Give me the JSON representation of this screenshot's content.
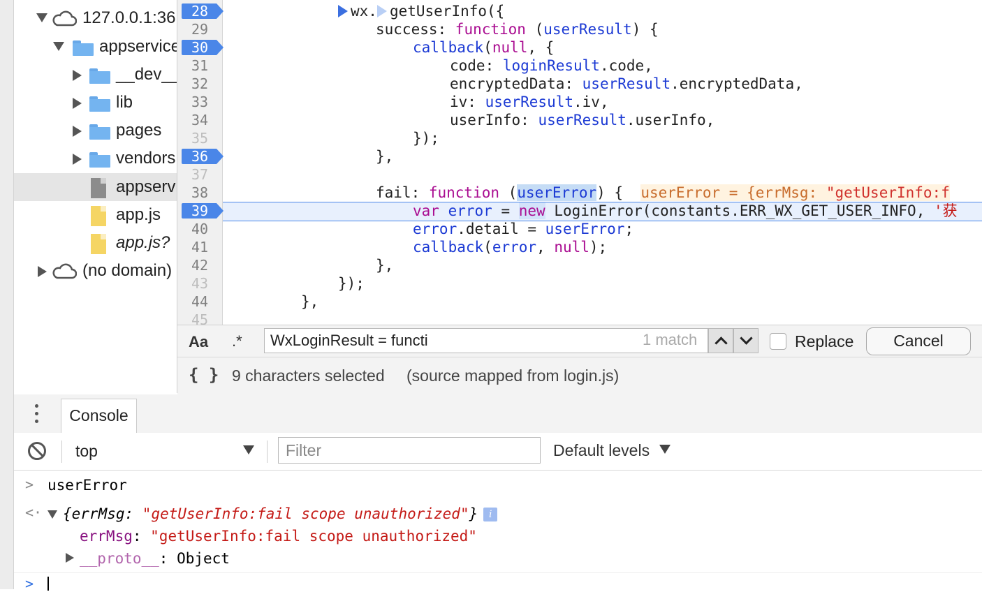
{
  "file_tree": {
    "items": [
      {
        "label": "127.0.0.1:36",
        "type": "domain",
        "expanded": true
      },
      {
        "label": "appservice",
        "type": "folder",
        "expanded": true
      },
      {
        "label": "__dev__",
        "type": "folder",
        "expanded": false
      },
      {
        "label": "lib",
        "type": "folder",
        "expanded": false
      },
      {
        "label": "pages",
        "type": "folder",
        "expanded": false
      },
      {
        "label": "vendors",
        "type": "folder",
        "expanded": false
      },
      {
        "label": "appservice",
        "type": "file",
        "selected": true
      },
      {
        "label": "app.js",
        "type": "file"
      },
      {
        "label": "app.js? ",
        "type": "file"
      },
      {
        "label": "(no domain)",
        "type": "domain",
        "expanded": false
      }
    ]
  },
  "editor": {
    "line_numbers": [
      "28",
      "29",
      "30",
      "31",
      "32",
      "33",
      "34",
      "35",
      "36",
      "37",
      "38",
      "39",
      "40",
      "41",
      "42",
      "43",
      "44",
      "45"
    ],
    "breakpoints": [
      "28",
      "30",
      "36",
      "39"
    ],
    "paused_line": "39",
    "code": {
      "l28_wx": "wx.",
      "l28_rest": "getUserInfo({",
      "l29_a": "success: ",
      "l29_kw": "function",
      "l29_b": " (",
      "l29_v": "userResult",
      "l29_c": ") {",
      "l30_a": "callback",
      "l30_b": "(",
      "l30_kw": "null",
      "l30_c": ", {",
      "l31_a": "code: ",
      "l31_v": "loginResult",
      "l31_b": ".code,",
      "l32_a": "encryptedData: ",
      "l32_v": "userResult",
      "l32_b": ".encryptedData,",
      "l33_a": "iv: ",
      "l33_v": "userResult",
      "l33_b": ".iv,",
      "l34_a": "userInfo: ",
      "l34_v": "userResult",
      "l34_b": ".userInfo,",
      "l35": "});",
      "l36": "},",
      "l38_a": "fail: ",
      "l38_kw": "function",
      "l38_b": " (",
      "l38_v": "userError",
      "l38_c": ") {  ",
      "l38_eval_a": "userError = {errMsg: ",
      "l38_eval_s": "\"getUserInfo:f",
      "l39_kw": "var",
      "l39_a": " ",
      "l39_v": "error",
      "l39_b": " = ",
      "l39_new": "new",
      "l39_c": " LoginError(constants.ERR_WX_GET_USER_INFO, ",
      "l39_s": "'获",
      "l40_v": "error",
      "l40_a": ".detail = ",
      "l40_v2": "userError",
      "l40_b": ";",
      "l41_a": "callback",
      "l41_b": "(",
      "l41_v": "error",
      "l41_c": ", ",
      "l41_kw": "null",
      "l41_d": ");",
      "l42": "},",
      "l43": "});",
      "l44": "},"
    }
  },
  "search_bar": {
    "case_toggle": "Aa",
    "regex_toggle": ".*",
    "query": "WxLoginResult = functi",
    "match_count": "1 match",
    "replace_label": "Replace",
    "replace_checked": false,
    "cancel_label": "Cancel"
  },
  "status_bar": {
    "pretty_print": "{ }",
    "selection": "9 characters selected",
    "source_map": "(source mapped from login.js)"
  },
  "drawer": {
    "tab_label": "Console"
  },
  "console_toolbar": {
    "context": "top",
    "filter_placeholder": "Filter",
    "levels": "Default levels"
  },
  "console_output": {
    "input_cmd": "userError",
    "result_open": "{errMsg: ",
    "result_str": "\"getUserInfo:fail scope unauthorized\"",
    "result_close": "}",
    "info_badge": "i",
    "prop_key": "errMsg",
    "prop_sep": ": ",
    "prop_val": "\"getUserInfo:fail scope unauthorized\"",
    "proto_key": "__proto__",
    "proto_sep": ": ",
    "proto_val": "Object"
  },
  "colors": {
    "breakpoint": "#4a86e8",
    "keyword": "#aa0d91",
    "variable": "#1c3ad4",
    "string": "#c41a16",
    "folder": "#74b4f0"
  }
}
